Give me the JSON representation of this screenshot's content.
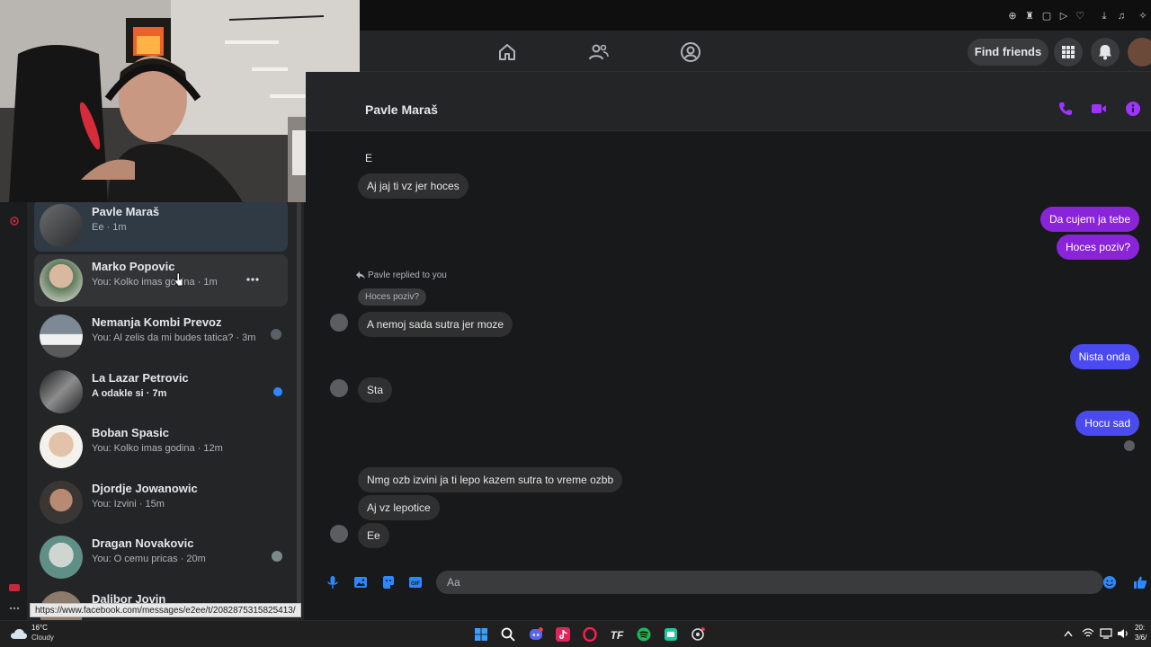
{
  "nav": {
    "find_friends": "Find friends"
  },
  "conversation": {
    "contact_name": "Pavle Maraš",
    "messages": [
      {
        "dir": "in",
        "text": "E"
      },
      {
        "dir": "in",
        "text": "Aj jaj ti vz jer hoces"
      },
      {
        "dir": "out",
        "text": "Da cujem ja tebe"
      },
      {
        "dir": "out",
        "text": "Hoces poziv?"
      },
      {
        "dir": "in",
        "text": "A nemoj sada sutra jer moze"
      },
      {
        "dir": "out",
        "text": "Nista onda"
      },
      {
        "dir": "in",
        "text": "Sta"
      },
      {
        "dir": "out",
        "text": "Hocu sad"
      },
      {
        "dir": "in",
        "text": "Nmg ozb izvini ja ti lepo  kazem sutra to vreme ozbb"
      },
      {
        "dir": "in",
        "text": "Aj vz lepotice"
      },
      {
        "dir": "in",
        "text": "Ee"
      }
    ],
    "reply_note": "Pavle replied to you",
    "quoted_text": "Hoces poziv?",
    "composer_placeholder": "Aa"
  },
  "chats": [
    {
      "name": "Pavle Maraš",
      "preview": "Ee · 1m",
      "active": true
    },
    {
      "name": "Marko Popovic",
      "preview": "You: Kolko imas godina · 1m"
    },
    {
      "name": "Nemanja Kombi Prevoz",
      "preview": "You: Al zelis da mi budes tatica? · 3m"
    },
    {
      "name": "La Lazar Petrovic",
      "preview": "A odakle si · 7m",
      "unread": true
    },
    {
      "name": "Boban Spasic",
      "preview": "You: Kolko imas godina · 12m"
    },
    {
      "name": "Djordje Jowanowic",
      "preview": "You: Izvini · 15m"
    },
    {
      "name": "Dragan Novakovic",
      "preview": "You: O cemu pricas · 20m"
    },
    {
      "name": "Dalibor Jovin",
      "preview": ""
    }
  ],
  "status_url": "https://www.facebook.com/messages/e2ee/t/2082875315825413/",
  "taskbar": {
    "temperature": "16°C",
    "weather": "Cloudy",
    "time": "20:",
    "date": "3/6/"
  },
  "colors": {
    "outgoing_bubble": "#8a24d9",
    "outgoing_bubble_alt": "#4a4af0",
    "call_icons": "#a033ff",
    "unread_dot": "#2d88ff"
  }
}
